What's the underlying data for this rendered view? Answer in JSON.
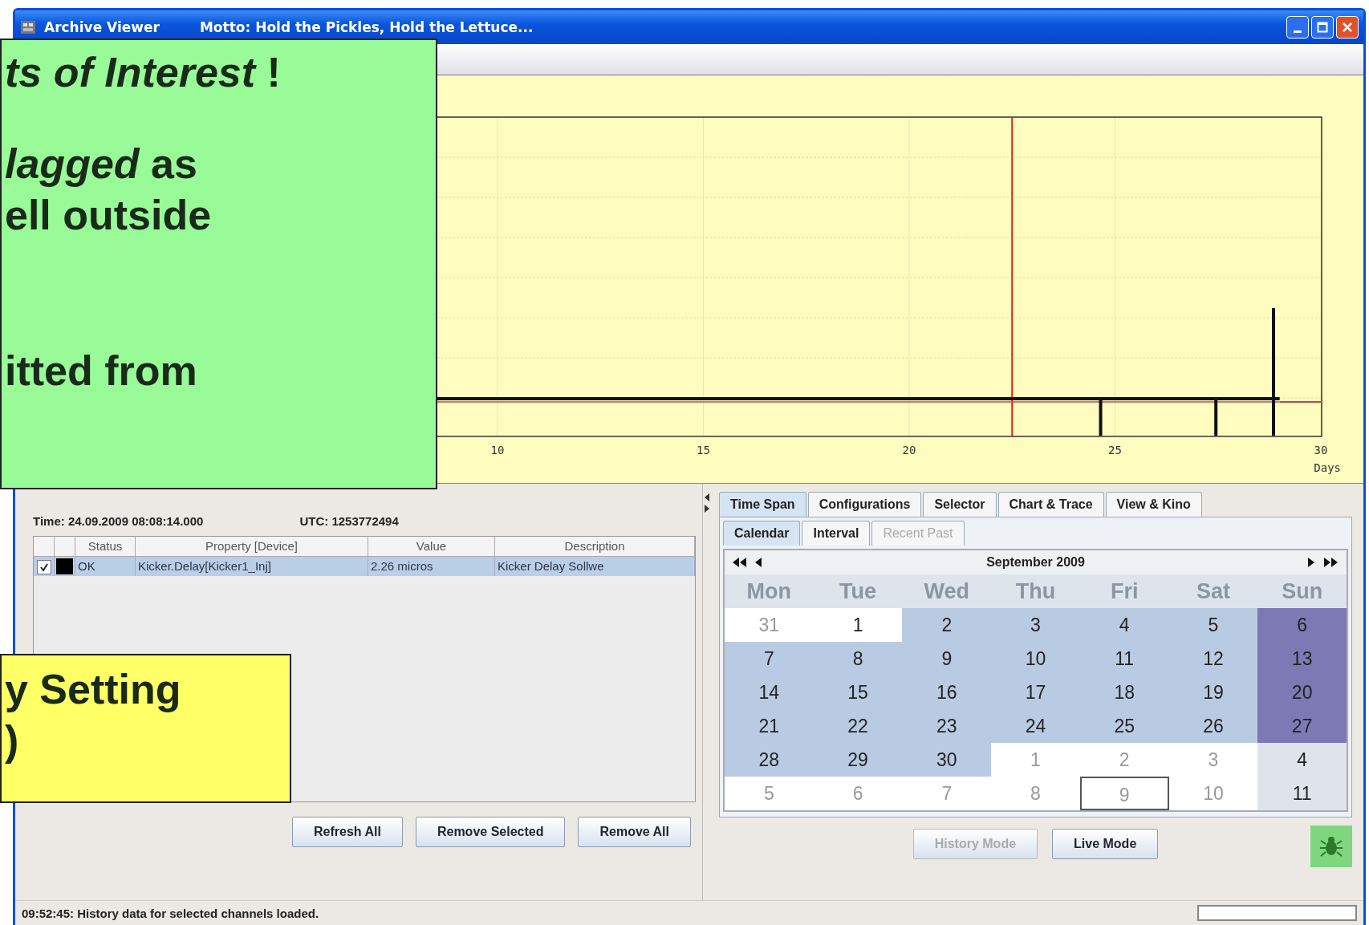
{
  "window": {
    "title": "Archive Viewer",
    "motto": "Motto: Hold the Pickles, Hold the Lettuce..."
  },
  "chart": {
    "x_tick_labels": [
      "10",
      "15",
      "20",
      "25",
      "30"
    ],
    "x_unit": "Days"
  },
  "callouts": [
    {
      "kind": "note",
      "paragraphs": [
        [
          "*ts of Interest* !"
        ],
        [
          "*lagged* as",
          "ell outside"
        ],
        [
          "itted from"
        ]
      ]
    },
    {
      "kind": "warning",
      "paragraphs": [
        [
          "y Setting",
          ")"
        ]
      ]
    }
  ],
  "readout": {
    "time": "Time: 24.09.2009 08:08:14.000",
    "utc": "UTC: 1253772494"
  },
  "table": {
    "columns": [
      "Status",
      "Property [Device]",
      "Value",
      "Description"
    ],
    "rows": [
      {
        "checked": true,
        "color": "#000000",
        "selected": true,
        "cells": [
          "OK",
          "Kicker.Delay[Kicker1_Inj]",
          "2.26 micros",
          "Kicker Delay Sollwe"
        ]
      }
    ]
  },
  "buttons": [
    "Refresh All",
    "Remove Selected",
    "Remove All"
  ],
  "tabs": [
    {
      "label": "Time Span",
      "selected": true
    },
    {
      "label": "Configurations",
      "selected": false
    },
    {
      "label": "Selector",
      "selected": false
    },
    {
      "label": "Chart & Trace",
      "selected": false
    },
    {
      "label": "View & Kino",
      "selected": false
    }
  ],
  "subtabs": [
    {
      "label": "Calendar",
      "selected": true,
      "disabled": false
    },
    {
      "label": "Interval",
      "selected": false,
      "disabled": false
    },
    {
      "label": "Recent Past",
      "selected": false,
      "disabled": true
    }
  ],
  "calendar": {
    "month": "September 2009",
    "weekdays": [
      "Mon",
      "Tue",
      "Wed",
      "Thu",
      "Fri",
      "Sat",
      "Sun"
    ],
    "weeks": [
      [
        {
          "day": "31",
          "selected": false,
          "muted": true,
          "today": false
        },
        {
          "day": "1",
          "selected": false,
          "muted": false,
          "today": false
        },
        {
          "day": "2",
          "selected": true,
          "muted": false,
          "today": false
        },
        {
          "day": "3",
          "selected": true,
          "muted": false,
          "today": false
        },
        {
          "day": "4",
          "selected": true,
          "muted": false,
          "today": false
        },
        {
          "day": "5",
          "selected": true,
          "muted": false,
          "today": false
        },
        {
          "day": "6",
          "selected": true,
          "muted": false,
          "today": false
        }
      ],
      [
        {
          "day": "7",
          "selected": true,
          "muted": false,
          "today": false
        },
        {
          "day": "8",
          "selected": true,
          "muted": false,
          "today": false
        },
        {
          "day": "9",
          "selected": true,
          "muted": false,
          "today": false
        },
        {
          "day": "10",
          "selected": true,
          "muted": false,
          "today": false
        },
        {
          "day": "11",
          "selected": true,
          "muted": false,
          "today": false
        },
        {
          "day": "12",
          "selected": true,
          "muted": false,
          "today": false
        },
        {
          "day": "13",
          "selected": true,
          "muted": false,
          "today": false
        }
      ],
      [
        {
          "day": "14",
          "selected": true,
          "muted": false,
          "today": false
        },
        {
          "day": "15",
          "selected": true,
          "muted": false,
          "today": false
        },
        {
          "day": "16",
          "selected": true,
          "muted": false,
          "today": false
        },
        {
          "day": "17",
          "selected": true,
          "muted": false,
          "today": false
        },
        {
          "day": "18",
          "selected": true,
          "muted": false,
          "today": false
        },
        {
          "day": "19",
          "selected": true,
          "muted": false,
          "today": false
        },
        {
          "day": "20",
          "selected": true,
          "muted": false,
          "today": false
        }
      ],
      [
        {
          "day": "21",
          "selected": true,
          "muted": false,
          "today": false
        },
        {
          "day": "22",
          "selected": true,
          "muted": false,
          "today": false
        },
        {
          "day": "23",
          "selected": true,
          "muted": false,
          "today": false
        },
        {
          "day": "24",
          "selected": true,
          "muted": false,
          "today": false
        },
        {
          "day": "25",
          "selected": true,
          "muted": false,
          "today": false
        },
        {
          "day": "26",
          "selected": true,
          "muted": false,
          "today": false
        },
        {
          "day": "27",
          "selected": true,
          "muted": false,
          "today": false
        }
      ],
      [
        {
          "day": "28",
          "selected": true,
          "muted": false,
          "today": false
        },
        {
          "day": "29",
          "selected": true,
          "muted": false,
          "today": false
        },
        {
          "day": "30",
          "selected": true,
          "muted": false,
          "today": false
        },
        {
          "day": "1",
          "selected": false,
          "muted": true,
          "today": false
        },
        {
          "day": "2",
          "selected": false,
          "muted": true,
          "today": false
        },
        {
          "day": "3",
          "selected": false,
          "muted": true,
          "today": false
        },
        {
          "day": "4",
          "selected": false,
          "muted": false,
          "today": false
        }
      ],
      [
        {
          "day": "5",
          "selected": false,
          "muted": true,
          "today": false
        },
        {
          "day": "6",
          "selected": false,
          "muted": true,
          "today": false
        },
        {
          "day": "7",
          "selected": false,
          "muted": true,
          "today": false
        },
        {
          "day": "8",
          "selected": false,
          "muted": true,
          "today": false
        },
        {
          "day": "9",
          "selected": false,
          "muted": true,
          "today": true
        },
        {
          "day": "10",
          "selected": false,
          "muted": true,
          "today": false
        },
        {
          "day": "11",
          "selected": false,
          "muted": false,
          "today": false
        }
      ]
    ]
  },
  "mode_buttons": [
    {
      "label": "History Mode",
      "disabled": true
    },
    {
      "label": "Live Mode",
      "disabled": false
    }
  ],
  "status_bar": {
    "message": "09:52:45: History data for selected channels loaded.",
    "progress": {
      "level": 0
    }
  }
}
